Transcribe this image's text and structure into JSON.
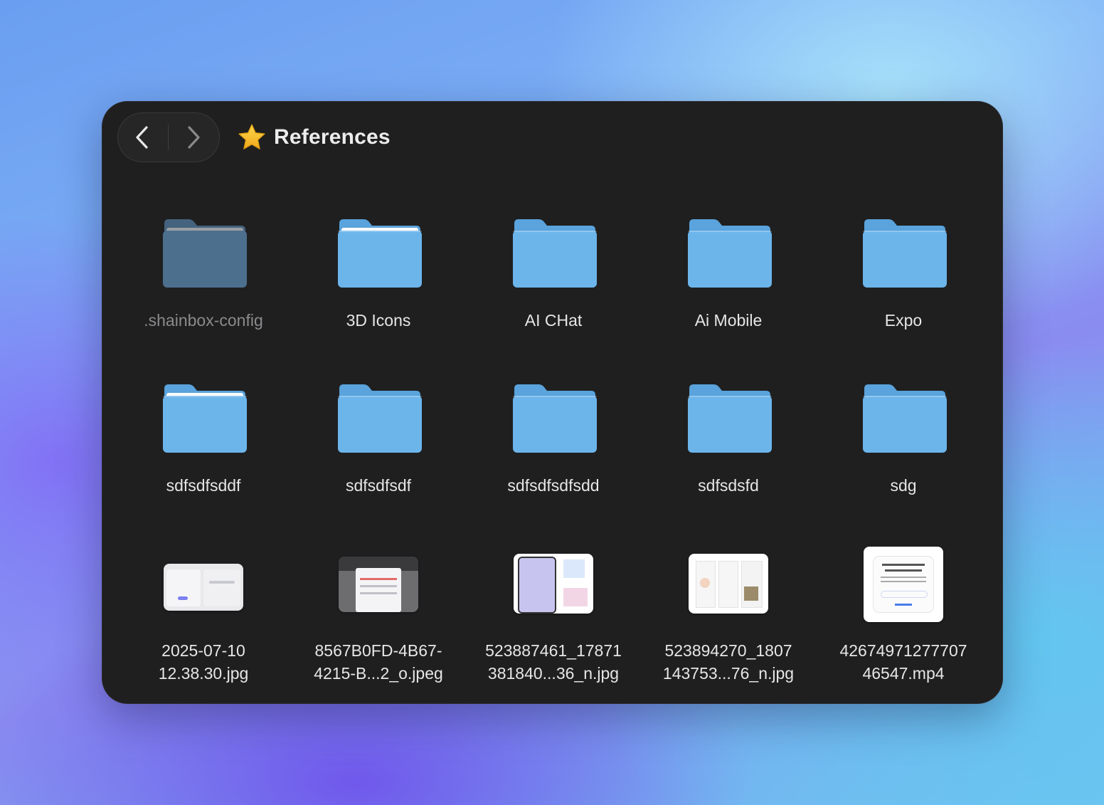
{
  "window": {
    "title": "References",
    "title_icon": "star-icon",
    "nav": {
      "back_icon": "chevron-left-icon",
      "forward_icon": "chevron-right-icon"
    }
  },
  "colors": {
    "folder_front": "#6cb5eb",
    "folder_back": "#5aa3dc",
    "folder_dim_front": "#4d6f8e",
    "window_bg": "#1f1f20",
    "star": "#f5c518"
  },
  "items": [
    {
      "label": ".shainbox-config",
      "type": "folder",
      "dim": true
    },
    {
      "label": "3D Icons",
      "type": "folder",
      "paper": true
    },
    {
      "label": "AI CHat",
      "type": "folder"
    },
    {
      "label": "Ai Mobile",
      "type": "folder"
    },
    {
      "label": "Expo",
      "type": "folder"
    },
    {
      "label": "sdfsdfsddf",
      "type": "folder",
      "paper": true
    },
    {
      "label": "sdfsdfsdf",
      "type": "folder"
    },
    {
      "label": "sdfsdfsdfsdd",
      "type": "folder"
    },
    {
      "label": "sdfsdsfd",
      "type": "folder"
    },
    {
      "label": "sdg",
      "type": "folder"
    },
    {
      "label": "2025-07-10\n12.38.30.jpg",
      "type": "image"
    },
    {
      "label": "8567B0FD-4B67-\n4215-B...2_o.jpeg",
      "type": "image"
    },
    {
      "label": "523887461_17871\n381840...36_n.jpg",
      "type": "image"
    },
    {
      "label": "523894270_1807\n143753...76_n.jpg",
      "type": "image"
    },
    {
      "label": "42674971277707\n46547.mp4",
      "type": "video"
    }
  ]
}
